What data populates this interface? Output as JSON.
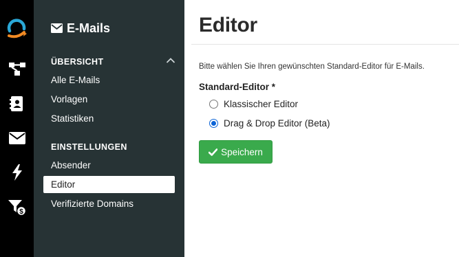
{
  "rail": {
    "items": [
      {
        "icon": "app-logo-icon"
      },
      {
        "icon": "flow-chart-icon"
      },
      {
        "icon": "contacts-icon"
      },
      {
        "icon": "envelope-icon"
      },
      {
        "icon": "lightning-icon"
      },
      {
        "icon": "funnel-dollar-icon"
      }
    ],
    "accent_colors": [
      "#2aa7d6",
      "#f08a24"
    ]
  },
  "sidebar": {
    "title": "E-Mails",
    "title_icon": "envelope-icon",
    "sections": [
      {
        "heading": "ÜBERSICHT",
        "items": [
          "Alle E-Mails",
          "Vorlagen",
          "Statistiken"
        ]
      },
      {
        "heading": "EINSTELLUNGEN",
        "items": [
          "Absender",
          "Editor",
          "Verifizierte Domains"
        ]
      }
    ],
    "active_item": "Editor",
    "background": "#273335"
  },
  "main": {
    "title": "Editor",
    "hint": "Bitte wählen Sie Ihren gewünschten Standard-Editor für E-Mails.",
    "field_label": "Standard-Editor *",
    "options": [
      {
        "label": "Klassischer Editor",
        "checked": false
      },
      {
        "label": "Drag & Drop Editor (Beta)",
        "checked": true
      }
    ],
    "save_label": "Speichern",
    "save_color": "#3aaa4c"
  }
}
